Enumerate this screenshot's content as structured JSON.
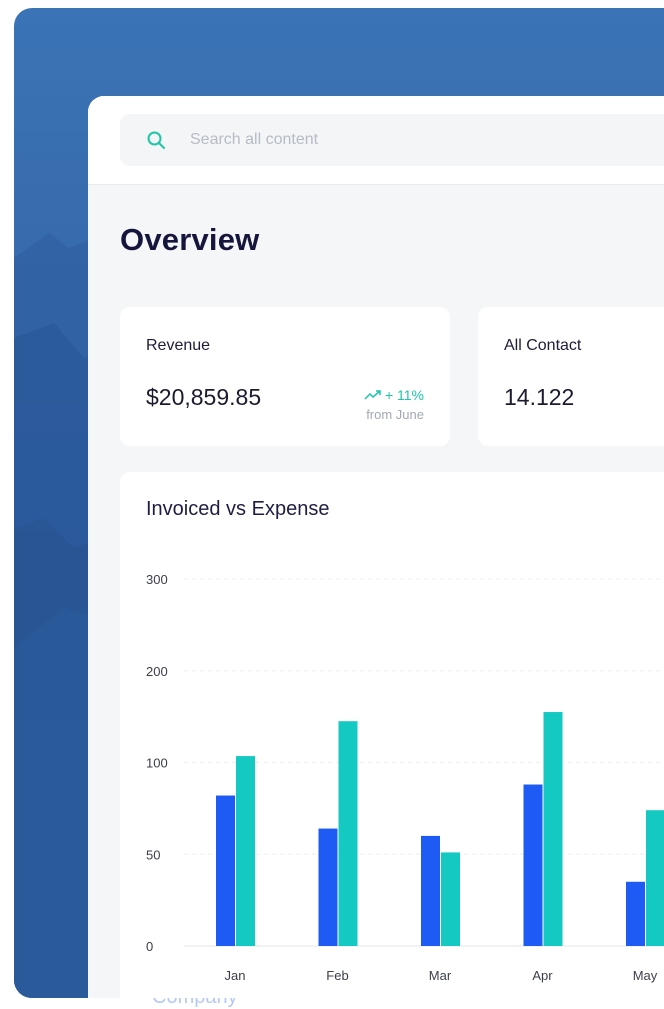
{
  "search": {
    "placeholder": "Search all content"
  },
  "page": {
    "title": "Overview"
  },
  "stats": [
    {
      "label": "Revenue",
      "value": "$20,859.85",
      "trend": "+ 11%",
      "trend_note": "from June"
    },
    {
      "label": "All Contact",
      "value": "14.122"
    }
  ],
  "background": {
    "faint_text": "Company"
  },
  "colors": {
    "invoiced": "#1e5bf5",
    "expense": "#14c9c2",
    "trend_up": "#1cc6a6",
    "search_icon": "#1cc6a6"
  },
  "icons": {
    "search": "search-icon",
    "trend": "trend-up-icon"
  },
  "chart_data": {
    "type": "bar",
    "title": "Invoiced vs Expense",
    "categories": [
      "Jan",
      "Feb",
      "Mar",
      "Apr",
      "May"
    ],
    "y_ticks": [
      0,
      50,
      100,
      200,
      300
    ],
    "ylim": [
      0,
      300
    ],
    "grid": true,
    "series": [
      {
        "values": [
          82,
          64,
          60,
          88,
          35
        ]
      },
      {
        "values": [
          107,
          145,
          51,
          155,
          74
        ]
      }
    ]
  }
}
